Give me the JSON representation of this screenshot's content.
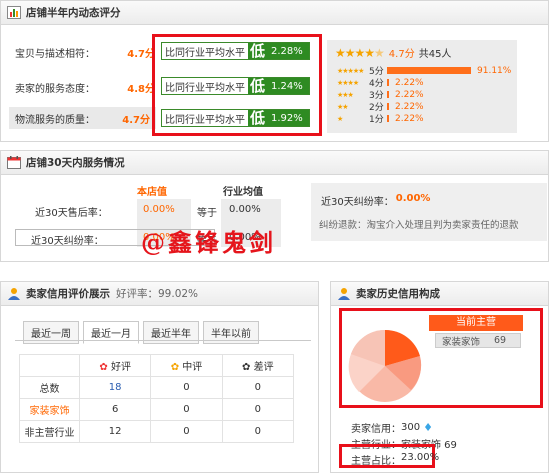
{
  "dsr": {
    "title": "店铺半年内动态评分",
    "rows": [
      {
        "label": "宝贝与描述相符：",
        "score": "4.7分",
        "compare_label": "比同行业平均水平",
        "level": "低",
        "pct": "2.28%"
      },
      {
        "label": "卖家的服务态度：",
        "score": "4.8分",
        "compare_label": "比同行业平均水平",
        "level": "低",
        "pct": "1.24%"
      },
      {
        "label": "物流服务的质量：",
        "score": "4.7分",
        "compare_label": "比同行业平均水平",
        "level": "低",
        "pct": "1.92%"
      }
    ],
    "summary_score": "4.7分",
    "summary_count": "共45人",
    "distribution": [
      {
        "label": "5分",
        "pct": "91.11%",
        "value": 91.11
      },
      {
        "label": "4分",
        "pct": "2.22%",
        "value": 2.22
      },
      {
        "label": "3分",
        "pct": "2.22%",
        "value": 2.22
      },
      {
        "label": "2分",
        "pct": "2.22%",
        "value": 2.22
      },
      {
        "label": "1分",
        "pct": "2.22%",
        "value": 2.22
      }
    ]
  },
  "service30": {
    "title": "店铺30天内服务情况",
    "col_shop": "本店值",
    "col_industry": "行业均值",
    "rows": [
      {
        "label": "近30天售后率：",
        "shop": "0.00%",
        "cmp": "等于",
        "industry": "0.00%"
      },
      {
        "label": "近30天纠纷率：",
        "shop": "0.00%",
        "cmp": "等于",
        "industry": "0.00%"
      }
    ],
    "dispute_title": "近30天纠纷率：",
    "dispute_value": "0.00%",
    "dispute_desc": "纠纷退款：淘宝介入处理且判为卖家责任的退款",
    "watermark": "@鑫锋鬼剑"
  },
  "credit": {
    "title": "卖家信用评价展示",
    "good_rate_label": "好评率：",
    "good_rate": "99.02%",
    "tabs": [
      "最近一周",
      "最近一月",
      "最近半年",
      "半年以前"
    ],
    "active_tab": 1,
    "headers": [
      "好评",
      "中评",
      "差评"
    ],
    "rows": [
      {
        "label": "总数",
        "good": "18",
        "mid": "0",
        "bad": "0"
      },
      {
        "label": "家装家饰",
        "good": "6",
        "mid": "0",
        "bad": "0"
      },
      {
        "label": "非主营行业",
        "good": "12",
        "mid": "0",
        "bad": "0"
      }
    ]
  },
  "history": {
    "title": "卖家历史信用构成",
    "main_label": "当前主营",
    "main_category": "家装家饰",
    "main_count": "69",
    "credit_label": "卖家信用：",
    "credit_value": "300",
    "main_biz_label": "主营行业：",
    "main_biz_value": "家装家饰 69",
    "share_label": "主营占比：",
    "share_value": "23.00%"
  },
  "colors": {
    "accent": "#ff6600",
    "green": "#2e8b22",
    "red_highlight": "#e8101a"
  }
}
